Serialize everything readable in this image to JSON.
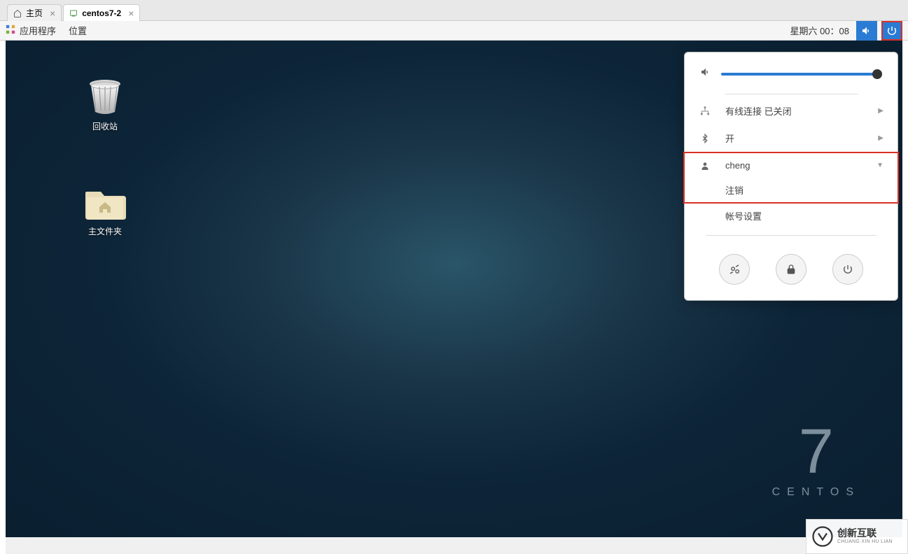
{
  "tabs": [
    {
      "label": "主页",
      "active": false
    },
    {
      "label": "centos7-2",
      "active": true
    }
  ],
  "gnome": {
    "applications": "应用程序",
    "places": "位置",
    "datetime": "星期六 00：08"
  },
  "desktop_icons": {
    "trash": "回收站",
    "home": "主文件夹"
  },
  "centos": {
    "number": "7",
    "name": "CENTOS"
  },
  "sysmenu": {
    "network_label": "有线连接 已关闭",
    "bluetooth_label": "开",
    "user": "cheng",
    "logout": "注销",
    "account_settings": "帐号设置"
  },
  "watermark": {
    "zh": "创新互联",
    "en": "CHUANG XIN HU LIAN"
  }
}
